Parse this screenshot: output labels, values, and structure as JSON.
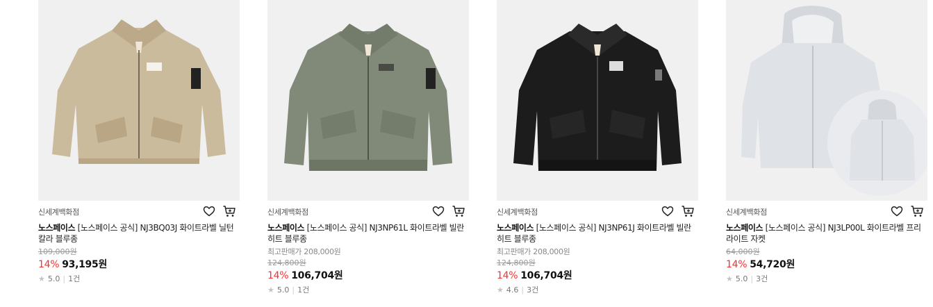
{
  "products": [
    {
      "store": "신세계백화점",
      "brand": "노스페이스",
      "title": "[노스페이스 공식] NJ3BQ03J 화이트라벨 닐턴 칼라 블루종",
      "best_price": "",
      "original_price": "109,000원",
      "discount": "14%",
      "price": "93,195원",
      "rating": "5.0",
      "reviews": "1건",
      "icons": {
        "wish": "heart-icon",
        "cart": "cart-icon",
        "star": "star-icon"
      },
      "colors": {
        "jacket": "#cbbb9d"
      }
    },
    {
      "store": "신세계백화점",
      "brand": "노스페이스",
      "title": "[노스페이스 공식] NJ3NP61L 화이트라벨 빌란 히트 블루종",
      "best_price": "최고판매가 208,000원",
      "original_price": "124,800원",
      "discount": "14%",
      "price": "106,704원",
      "rating": "5.0",
      "reviews": "1건",
      "icons": {
        "wish": "heart-icon",
        "cart": "cart-icon",
        "star": "star-icon"
      },
      "colors": {
        "jacket": "#818a78"
      }
    },
    {
      "store": "신세계백화점",
      "brand": "노스페이스",
      "title": "[노스페이스 공식] NJ3NP61J 화이트라벨 빌란 히트 블루종",
      "best_price": "최고판매가 208,000원",
      "original_price": "124,800원",
      "discount": "14%",
      "price": "106,704원",
      "rating": "4.6",
      "reviews": "3건",
      "icons": {
        "wish": "heart-icon",
        "cart": "cart-icon",
        "star": "star-icon"
      },
      "colors": {
        "jacket": "#1c1c1c"
      }
    },
    {
      "store": "신세계백화점",
      "brand": "노스페이스",
      "title": "[노스페이스 공식] NJ3LP00L 화이트라벨 프리 라이트 자켓",
      "best_price": "",
      "original_price": "64,000원",
      "discount": "14%",
      "price": "54,720원",
      "rating": "5.0",
      "reviews": "3건",
      "icons": {
        "wish": "heart-icon",
        "cart": "cart-icon",
        "star": "star-icon"
      },
      "colors": {
        "jacket": "#dfe2e6"
      }
    }
  ]
}
